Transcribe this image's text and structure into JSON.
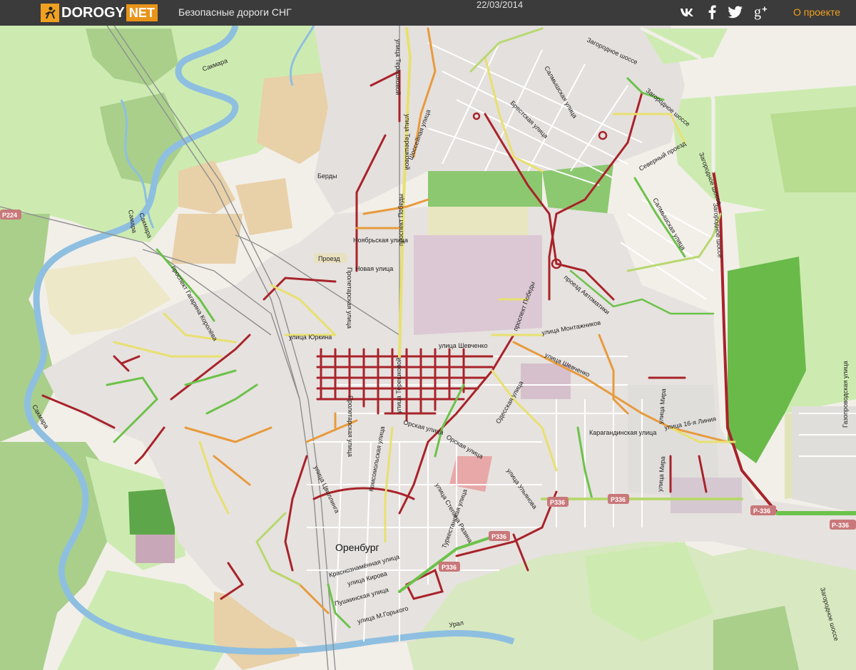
{
  "header": {
    "logo_main": "DOROGY",
    "logo_suffix": "NET",
    "tagline": "Безопасные дороги СНГ",
    "date": "22/03/2014",
    "about_label": "О проекте",
    "social": [
      {
        "name": "vk-icon",
        "glyph": "vk"
      },
      {
        "name": "facebook-icon",
        "glyph": "f"
      },
      {
        "name": "twitter-icon",
        "glyph": "t"
      },
      {
        "name": "google-plus-icon",
        "glyph": "g+"
      }
    ]
  },
  "map": {
    "city_label": "Оренбург",
    "place_labels": {
      "berdy": "Берды",
      "proezd": "Проезд"
    },
    "river_labels": {
      "sakmara_top": "Сакмара",
      "sakmara_mid": "Сакмара",
      "sakmara_left": "Сакмара",
      "ural": "Урал"
    },
    "route_shields": {
      "p224": "P224",
      "p336_a": "P336",
      "p336_b": "P336",
      "p336_c": "P336",
      "p336_d": "P336",
      "p336_e": "P-336",
      "p336_f": "P-336"
    },
    "street_labels": {
      "zagorodnoe_1": "Загородное шоссе",
      "zagorodnoe_2": "Загородное шоссе",
      "zagorodnoe_3": "Загородное шоссе",
      "zagorodnoe_4": "Загородное шоссе",
      "zagorodnoe_5": "Загородное шоссе",
      "salmyshskaya_1": "Салмышская улица",
      "salmyshskaya_2": "Салмышская улица",
      "brestskaya": "Брестская улица",
      "shosseynaya": "Шоссейная улица",
      "terekhova_1": "улица Терешковой",
      "terekhova_2": "улица Терешковой",
      "terekhova_3": "улица Терешковой",
      "severny": "Северный проезд",
      "noyabrskaya": "Ноябрьская улица",
      "novaya": "Новая улица",
      "pr_pobedy_1": "проспект Победы",
      "pr_pobedy_2": "проспект Победы",
      "pr_avtomatiki": "проезд Автоматики",
      "montazhnikov": "улица Монтажников",
      "shevchenko_1": "улица Шевченко",
      "shevchenko_2": "улица Шевченко",
      "yurkina": "улица Юркина",
      "proletarskaya_1": "Пролетарская улица",
      "proletarskaya_2": "Пролетарская улица",
      "pr_korolyova": "проспект Гагарина Королёва",
      "komsomolskaya": "Комсомольская улица",
      "orskaya_1": "Орская улица",
      "orskaya_2": "Орская улица",
      "odesskaya": "Одесская улица",
      "karagandinskaya": "Карагандинская улица",
      "mira_1": "улица Мира",
      "mira_2": "улица Мира",
      "liniya_16": "улица 16-я Линия",
      "tsvillinga": "улица Цвиллинга",
      "stepana_razina": "улица Степана Разина",
      "turkestanskaya": "Туркестанская улица",
      "ulyanova": "улица Ульянова",
      "gazoprovodskaya": "Газопроводская улица",
      "krasnoznamennaya": "Краснознамённая улица",
      "kirova": "улица Кирова",
      "pushkinskaya": "Пушкинская улица",
      "gorkogo": "улица М.Горького",
      "samara": "Самара"
    },
    "colors": {
      "background": "#f2efe9",
      "forest": "#a9cf8b",
      "green_light": "#cdebb0",
      "meadow": "#d8e8c0",
      "water": "#8ebfe0",
      "residential": "#e0dfdf",
      "industrial": "#dbc9d6",
      "farmland": "#ede8c8",
      "scrub": "#e8d0a8",
      "road_red": "#a8232a",
      "road_orange": "#e89a3c",
      "road_yellow": "#e8e070",
      "road_green": "#6cc24a",
      "road_lightgreen": "#b8d870",
      "shield": "#c9787a"
    }
  }
}
